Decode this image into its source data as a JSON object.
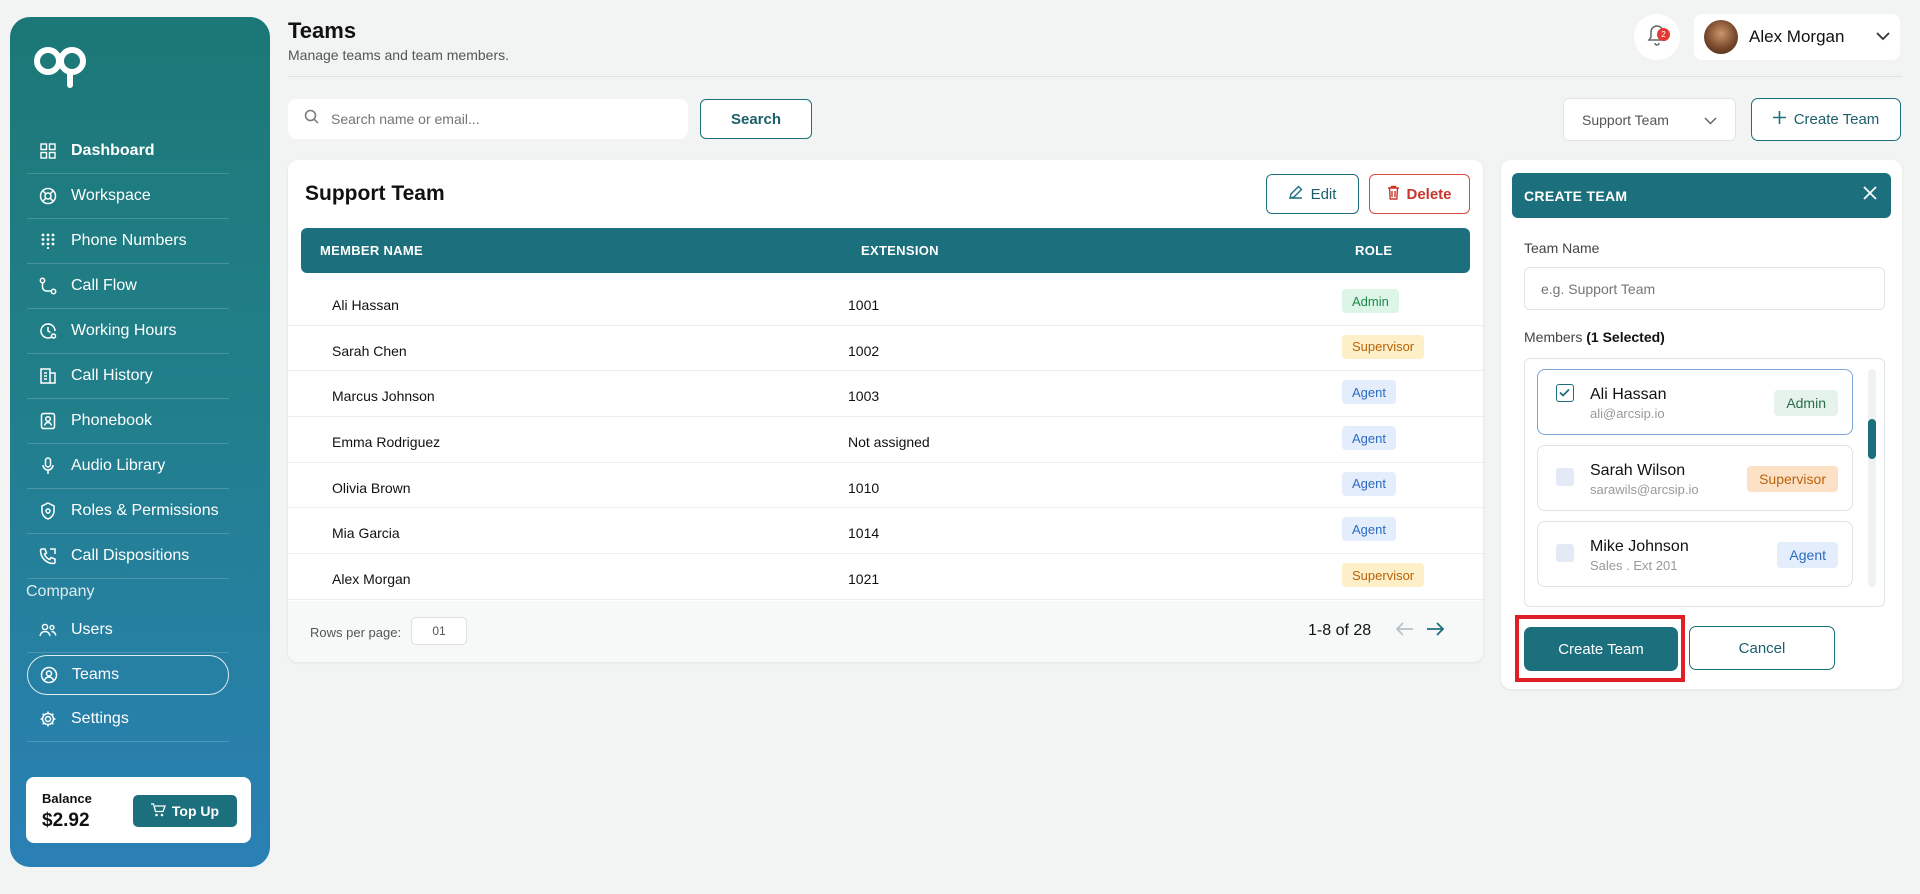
{
  "sidebar": {
    "nav": [
      {
        "label": "Dashboard",
        "icon": "grid-icon"
      },
      {
        "label": "Workspace",
        "icon": "lifebuoy-icon"
      },
      {
        "label": "Phone Numbers",
        "icon": "dialpad-icon"
      },
      {
        "label": "Call Flow",
        "icon": "flow-icon"
      },
      {
        "label": "Working Hours",
        "icon": "clock-icon"
      },
      {
        "label": "Call History",
        "icon": "history-icon"
      },
      {
        "label": "Phonebook",
        "icon": "contact-book-icon"
      },
      {
        "label": "Audio Library",
        "icon": "microphone-icon"
      },
      {
        "label": "Roles & Permissions",
        "icon": "shield-icon"
      },
      {
        "label": "Call Dispositions",
        "icon": "phone-icon"
      }
    ],
    "section_label": "Company",
    "company_nav": [
      {
        "label": "Users",
        "icon": "users-icon"
      },
      {
        "label": "Teams",
        "icon": "team-icon"
      },
      {
        "label": "Settings",
        "icon": "gear-icon"
      }
    ],
    "balance": {
      "label": "Balance",
      "value": "$2.92",
      "topup_label": "Top Up"
    }
  },
  "header": {
    "title": "Teams",
    "subtitle": "Manage teams and team members.",
    "notification_count": "2",
    "user_name": "Alex Morgan"
  },
  "toolbar": {
    "search_placeholder": "Search name or email...",
    "search_label": "Search",
    "team_select_value": "Support Team",
    "create_label": "Create Team"
  },
  "team_card": {
    "title": "Support Team",
    "edit_label": "Edit",
    "delete_label": "Delete",
    "columns": [
      "MEMBER NAME",
      "EXTENSION",
      "ROLE"
    ],
    "rows": [
      {
        "name": "Ali Hassan",
        "ext": "1001",
        "role": "Admin"
      },
      {
        "name": "Sarah Chen",
        "ext": "1002",
        "role": "Supervisor"
      },
      {
        "name": "Marcus Johnson",
        "ext": "1003",
        "role": "Agent"
      },
      {
        "name": "Emma Rodriguez",
        "ext": "Not assigned",
        "role": "Agent"
      },
      {
        "name": "Olivia Brown",
        "ext": "1010",
        "role": "Agent"
      },
      {
        "name": "Mia Garcia",
        "ext": "1014",
        "role": "Agent"
      },
      {
        "name": "Alex Morgan",
        "ext": "1021",
        "role": "Supervisor"
      }
    ],
    "rows_per_page_label": "Rows per page:",
    "rows_per_page_value": "01",
    "page_info": "1-8 of 28"
  },
  "create_panel": {
    "title": "CREATE TEAM",
    "team_name_label": "Team Name",
    "team_name_placeholder": "e.g. Support Team",
    "members_label": "Members",
    "members_selected": "(1 Selected)",
    "members": [
      {
        "name": "Ali Hassan",
        "sub": "ali@arcsip.io",
        "role": "Admin",
        "selected": true
      },
      {
        "name": "Sarah Wilson",
        "sub": "sarawils@arcsip.io",
        "role": "Supervisor",
        "selected": false
      },
      {
        "name": "Mike Johnson",
        "sub": "Sales . Ext 201",
        "role": "Agent",
        "selected": false
      }
    ],
    "create_label": "Create Team",
    "cancel_label": "Cancel"
  },
  "colors": {
    "primary": "#1c6f7c",
    "highlight": "#e01f26"
  }
}
